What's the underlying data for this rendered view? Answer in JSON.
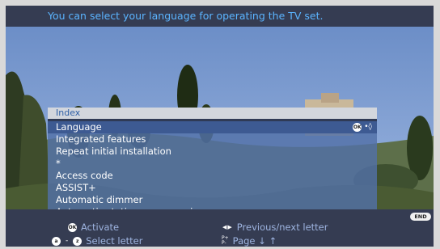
{
  "hint": "You can select your language for operating the TV set.",
  "menu": {
    "title": "Index",
    "items": [
      {
        "label": "Language",
        "selected": true
      },
      {
        "label": "Integrated features",
        "selected": false
      },
      {
        "label": "Repeat initial installation",
        "selected": false
      },
      {
        "label": "*",
        "selected": false
      },
      {
        "label": "Access code",
        "selected": false
      },
      {
        "label": "ASSIST+",
        "selected": false
      },
      {
        "label": "Automatic dimmer",
        "selected": false
      },
      {
        "label": "Automatic station programming",
        "selected": false
      }
    ],
    "ok_badge": "OK"
  },
  "footer": {
    "end_label": "END",
    "ok_badge": "OK",
    "activate_label": "Activate",
    "prev_next_label": "Previous/next letter",
    "badge_a": "a",
    "badge_z": "z",
    "select_letter_label": "Select letter",
    "page_label": "Page ↓ ↑"
  },
  "colors": {
    "hint_text": "#5bb4ff",
    "menu_title_bg": "#d2d6dd",
    "menu_title_text": "#2f5fa6",
    "menu_bg": "#5270a7",
    "selected_bg": "#3d5a92",
    "footer_bg": "#353c52"
  },
  "icons": {
    "ok_button": "ok-icon",
    "navigate": "navigate-arrows-icon",
    "left_right": "left-right-arrows-icon",
    "page_keys": "page-up-down-icon"
  }
}
